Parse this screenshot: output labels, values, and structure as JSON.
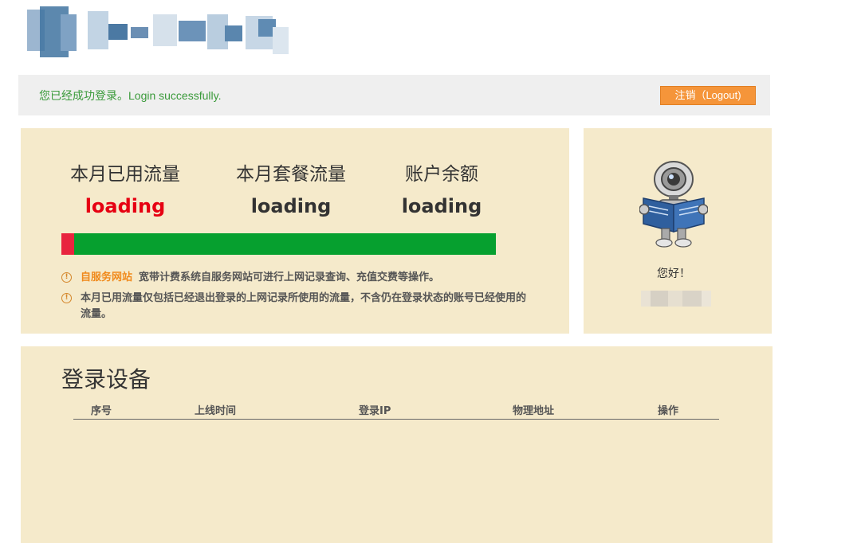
{
  "header": {
    "logo": "blurred-site-logo"
  },
  "login_bar": {
    "message": "您已经成功登录。Login successfully.",
    "logout_label": "注销（Logout)",
    "logout_color": "#f5953a"
  },
  "flow": {
    "used_label": "本月已用流量",
    "used_value": "loading",
    "plan_label": "本月套餐流量",
    "plan_value": "loading",
    "balance_label": "账户余额",
    "balance_value": "loading",
    "usage_fraction": 0.03,
    "used_color": "#e8243f",
    "remaining_color": "#06a02f",
    "notes": [
      {
        "link": "自服务网站",
        "text": "宽带计费系统自服务网站可进行上网记录查询、充值交费等操作。"
      },
      {
        "link": "",
        "text": "本月已用流量仅包括已经退出登录的上网记录所使用的流量，不含仍在登录状态的账号已经使用的流量。"
      }
    ]
  },
  "user": {
    "greeting": "您好！",
    "avatar": "robot-reading-book-icon"
  },
  "devices": {
    "title": "登录设备",
    "columns": [
      "序号",
      "上线时间",
      "登录IP",
      "物理地址",
      "操作"
    ]
  }
}
